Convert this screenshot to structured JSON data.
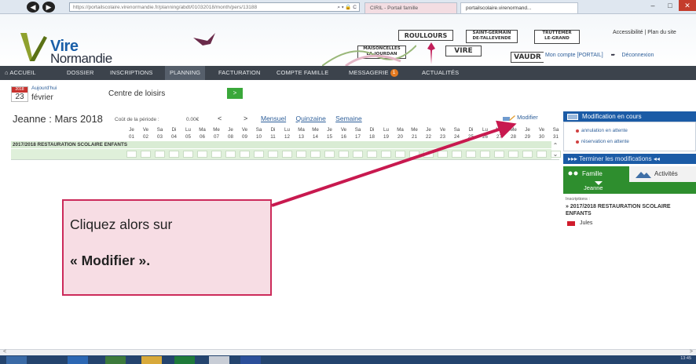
{
  "browser": {
    "address": "https://portailscolaire.virenormandie.fr/planning/abdt/01032018/month/pers/13188",
    "address_host": "portailscolaire.virenormandie.fr",
    "tab_ciril": "CIRIL - Portail famille",
    "tab_portal": "portailscolaire.virenormand..."
  },
  "logo": {
    "word1": "Vire",
    "word2": "Normandie"
  },
  "signs": {
    "roullours": "ROULLOURS",
    "saint_germain_line1": "SAINT-GERMAIN",
    "saint_germain_line2": "DE-TALLEVENDE",
    "truttemer_line1": "TRUTTEMER",
    "truttemer_line2": "LE-GRAND",
    "maisoncelles_line1": "MAISONCELLES",
    "maisoncelles_line2": "LA-JOURDAN",
    "vire": "VIRE",
    "vaudr": "VAUDR"
  },
  "account": {
    "accessibility": "Accessibilité",
    "sitemap": "Plan du site",
    "my_account": "Mon compte [PORTAIL]",
    "logout": "Déconnexion"
  },
  "nav": {
    "home": "ACCUEIL",
    "dossier": "DOSSIER",
    "inscriptions": "INSCRIPTIONS",
    "planning": "PLANNING",
    "facturation": "FACTURATION",
    "compte_famille": "COMPTE FAMILLE",
    "messagerie": "MESSAGERIE",
    "messagerie_count": "1",
    "actualites": "ACTUALITÉS"
  },
  "date_block": {
    "year": "2018",
    "day": "23",
    "today_label": "Aujourd'hui",
    "month": "février"
  },
  "center": {
    "label": "Centre de loisirs",
    "go": ">"
  },
  "planning": {
    "title": "Jeanne : Mars 2018",
    "cost_label": "Coût de la période :",
    "cost_value": "0.00€",
    "prev": "<",
    "next": ">",
    "view_monthly": "Mensuel",
    "view_fortnight": "Quinzaine",
    "view_weekly": "Semaine",
    "edit": "Modifier",
    "days": [
      "Je",
      "Ve",
      "Sa",
      "Di",
      "Lu",
      "Ma",
      "Me",
      "Je",
      "Ve",
      "Sa",
      "Di",
      "Lu",
      "Ma",
      "Me",
      "Je",
      "Ve",
      "Sa",
      "Di",
      "Lu",
      "Ma",
      "Me",
      "Je",
      "Ve",
      "Sa",
      "Di",
      "Lu",
      "Ma",
      "Me",
      "Je",
      "Ve",
      "Sa"
    ],
    "numbers": [
      "01",
      "02",
      "03",
      "04",
      "05",
      "06",
      "07",
      "08",
      "09",
      "10",
      "11",
      "12",
      "13",
      "14",
      "15",
      "16",
      "17",
      "18",
      "19",
      "20",
      "21",
      "22",
      "23",
      "24",
      "25",
      "26",
      "27",
      "28",
      "29",
      "30",
      "31"
    ],
    "category": "2017/2018 RESTAURATION SCOLAIRE ENFANTS"
  },
  "right_panel": {
    "header": "Modification en cours",
    "cancel_pending": "annulation en attente",
    "booking_pending": "réservation en attente",
    "finish": "Terminer les modifications",
    "tab_family": "Famille",
    "tab_activities": "Activités",
    "member": "Jeanne",
    "inscriptions_label": "Inscriptions :",
    "inscription_item": "» 2017/2018 RESTAURATION SCOLAIRE ENFANTS",
    "child": "Jules"
  },
  "callout": {
    "line1": "Cliquez alors sur",
    "line2": "« Modifier »."
  },
  "taskbar": {
    "clock": "13:45"
  },
  "colors": {
    "nav_bg": "#3c434c",
    "panel_blue": "#1b5ba6",
    "family_green": "#2e8e2e",
    "grid_green": "#dff0da",
    "callout_border": "#cc2a5a",
    "callout_bg": "#f7dde4"
  }
}
